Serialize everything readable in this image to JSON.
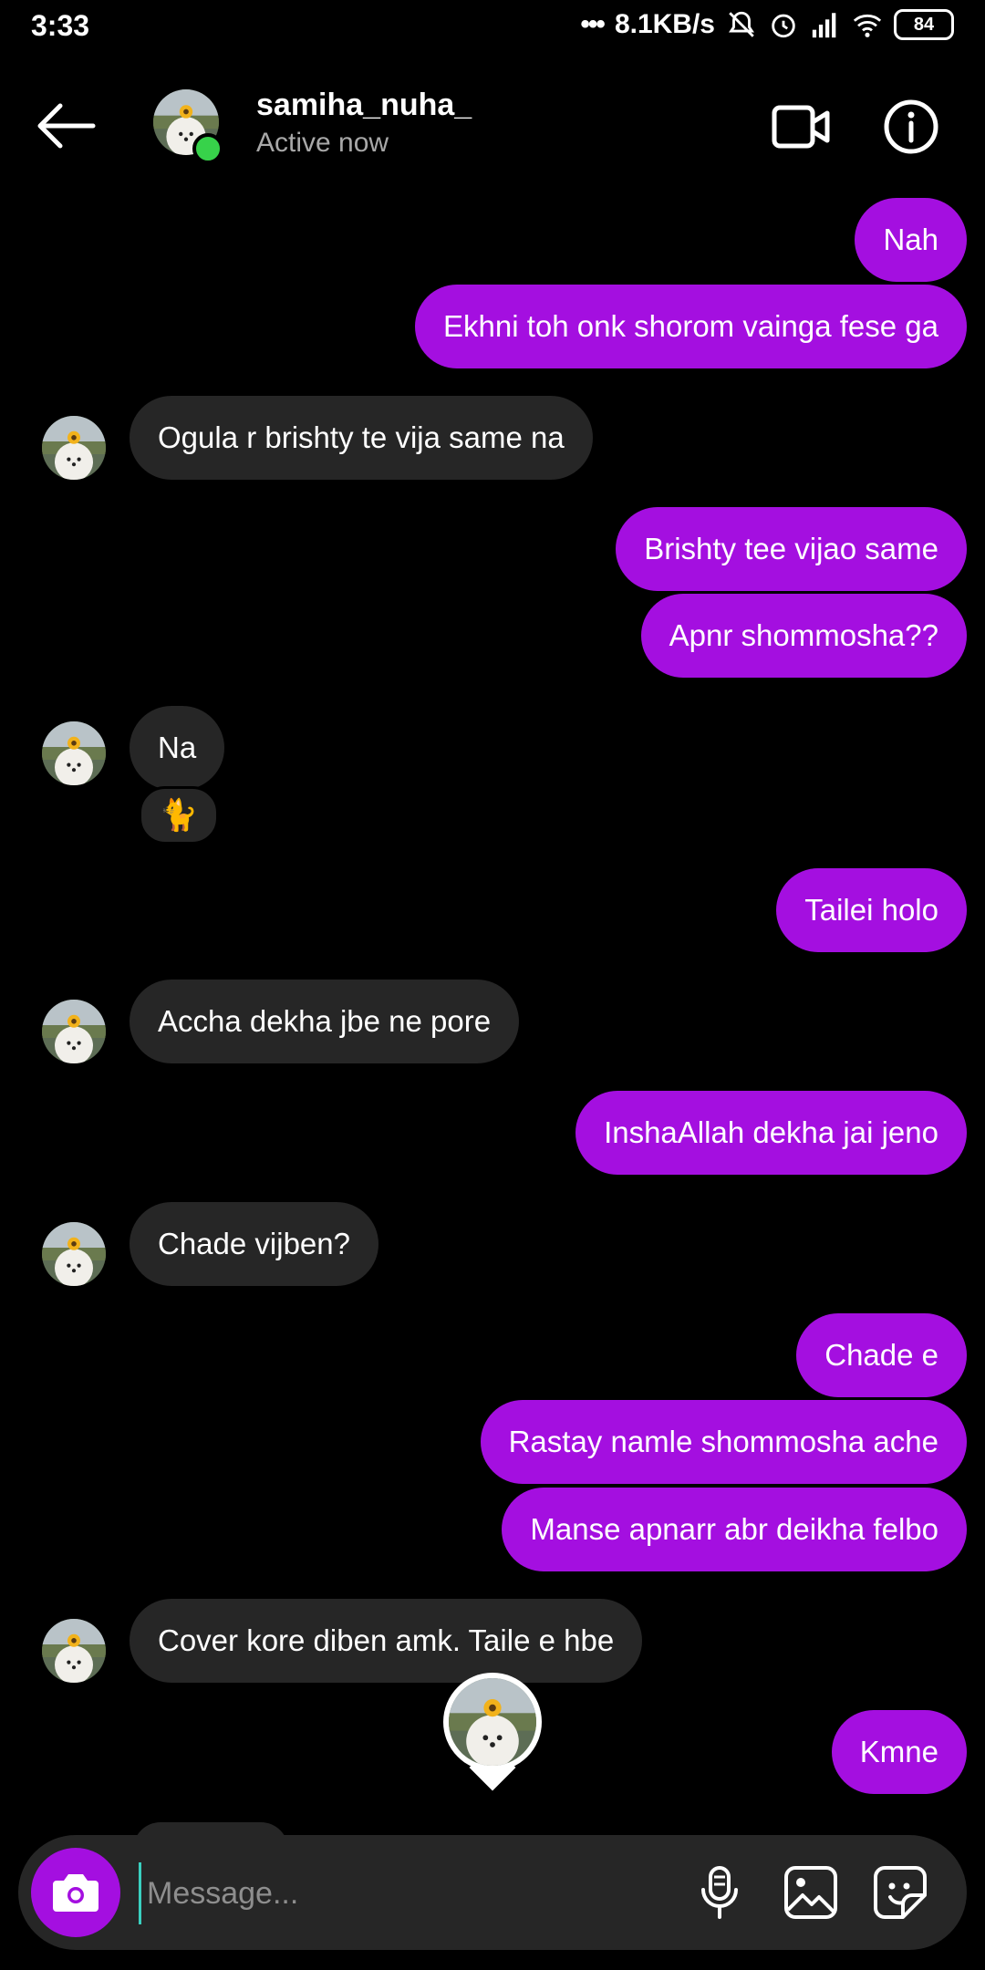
{
  "status_bar": {
    "time": "3:33",
    "network_speed": "8.1KB/s",
    "battery": "84",
    "icons": [
      "dots-icon",
      "mute-bell-icon",
      "alarm-icon",
      "signal-icon",
      "wifi-icon",
      "battery-icon"
    ]
  },
  "header": {
    "username": "samiha_nuha_",
    "status": "Active now",
    "icons": [
      "back-arrow-icon",
      "video-call-icon",
      "info-icon"
    ]
  },
  "colors": {
    "background": "#000000",
    "outgoing_bubble": "#a40fe0",
    "incoming_bubble": "#262626",
    "online_dot": "#37d24a"
  },
  "messages": [
    {
      "from": "me",
      "text": "Nah"
    },
    {
      "from": "me",
      "text": "Ekhni toh onk shorom vainga fese ga"
    },
    {
      "from": "them",
      "text": "Ogula r brishty te vija same na"
    },
    {
      "from": "me",
      "text": "Brishty tee vijao same"
    },
    {
      "from": "me",
      "text": "Apnr shommosha??"
    },
    {
      "from": "them",
      "text": "Na",
      "reaction": "🐈"
    },
    {
      "from": "me",
      "text": "Tailei holo"
    },
    {
      "from": "them",
      "text": "Accha dekha jbe ne pore"
    },
    {
      "from": "me",
      "text": "InshaAllah dekha jai jeno"
    },
    {
      "from": "them",
      "text": "Chade vijben?"
    },
    {
      "from": "me",
      "text": "Chade e"
    },
    {
      "from": "me",
      "text": "Rastay namle shommosha ache"
    },
    {
      "from": "me",
      "text": "Manse apnarr abr deikha felbo"
    },
    {
      "from": "them",
      "text": "Cover kore diben amk. Taile e hbe"
    },
    {
      "from": "me",
      "text": "Kmne"
    }
  ],
  "composer": {
    "placeholder": "Message...",
    "icons": [
      "camera-icon",
      "microphone-icon",
      "gallery-icon",
      "sticker-icon"
    ]
  }
}
